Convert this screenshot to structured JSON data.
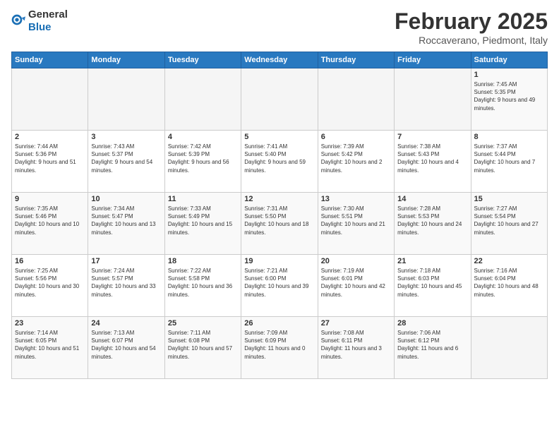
{
  "logo": {
    "general": "General",
    "blue": "Blue"
  },
  "header": {
    "month": "February 2025",
    "location": "Roccaverano, Piedmont, Italy"
  },
  "weekdays": [
    "Sunday",
    "Monday",
    "Tuesday",
    "Wednesday",
    "Thursday",
    "Friday",
    "Saturday"
  ],
  "weeks": [
    [
      {
        "day": "",
        "info": ""
      },
      {
        "day": "",
        "info": ""
      },
      {
        "day": "",
        "info": ""
      },
      {
        "day": "",
        "info": ""
      },
      {
        "day": "",
        "info": ""
      },
      {
        "day": "",
        "info": ""
      },
      {
        "day": "1",
        "info": "Sunrise: 7:45 AM\nSunset: 5:35 PM\nDaylight: 9 hours and 49 minutes."
      }
    ],
    [
      {
        "day": "2",
        "info": "Sunrise: 7:44 AM\nSunset: 5:36 PM\nDaylight: 9 hours and 51 minutes."
      },
      {
        "day": "3",
        "info": "Sunrise: 7:43 AM\nSunset: 5:37 PM\nDaylight: 9 hours and 54 minutes."
      },
      {
        "day": "4",
        "info": "Sunrise: 7:42 AM\nSunset: 5:39 PM\nDaylight: 9 hours and 56 minutes."
      },
      {
        "day": "5",
        "info": "Sunrise: 7:41 AM\nSunset: 5:40 PM\nDaylight: 9 hours and 59 minutes."
      },
      {
        "day": "6",
        "info": "Sunrise: 7:39 AM\nSunset: 5:42 PM\nDaylight: 10 hours and 2 minutes."
      },
      {
        "day": "7",
        "info": "Sunrise: 7:38 AM\nSunset: 5:43 PM\nDaylight: 10 hours and 4 minutes."
      },
      {
        "day": "8",
        "info": "Sunrise: 7:37 AM\nSunset: 5:44 PM\nDaylight: 10 hours and 7 minutes."
      }
    ],
    [
      {
        "day": "9",
        "info": "Sunrise: 7:35 AM\nSunset: 5:46 PM\nDaylight: 10 hours and 10 minutes."
      },
      {
        "day": "10",
        "info": "Sunrise: 7:34 AM\nSunset: 5:47 PM\nDaylight: 10 hours and 13 minutes."
      },
      {
        "day": "11",
        "info": "Sunrise: 7:33 AM\nSunset: 5:49 PM\nDaylight: 10 hours and 15 minutes."
      },
      {
        "day": "12",
        "info": "Sunrise: 7:31 AM\nSunset: 5:50 PM\nDaylight: 10 hours and 18 minutes."
      },
      {
        "day": "13",
        "info": "Sunrise: 7:30 AM\nSunset: 5:51 PM\nDaylight: 10 hours and 21 minutes."
      },
      {
        "day": "14",
        "info": "Sunrise: 7:28 AM\nSunset: 5:53 PM\nDaylight: 10 hours and 24 minutes."
      },
      {
        "day": "15",
        "info": "Sunrise: 7:27 AM\nSunset: 5:54 PM\nDaylight: 10 hours and 27 minutes."
      }
    ],
    [
      {
        "day": "16",
        "info": "Sunrise: 7:25 AM\nSunset: 5:56 PM\nDaylight: 10 hours and 30 minutes."
      },
      {
        "day": "17",
        "info": "Sunrise: 7:24 AM\nSunset: 5:57 PM\nDaylight: 10 hours and 33 minutes."
      },
      {
        "day": "18",
        "info": "Sunrise: 7:22 AM\nSunset: 5:58 PM\nDaylight: 10 hours and 36 minutes."
      },
      {
        "day": "19",
        "info": "Sunrise: 7:21 AM\nSunset: 6:00 PM\nDaylight: 10 hours and 39 minutes."
      },
      {
        "day": "20",
        "info": "Sunrise: 7:19 AM\nSunset: 6:01 PM\nDaylight: 10 hours and 42 minutes."
      },
      {
        "day": "21",
        "info": "Sunrise: 7:18 AM\nSunset: 6:03 PM\nDaylight: 10 hours and 45 minutes."
      },
      {
        "day": "22",
        "info": "Sunrise: 7:16 AM\nSunset: 6:04 PM\nDaylight: 10 hours and 48 minutes."
      }
    ],
    [
      {
        "day": "23",
        "info": "Sunrise: 7:14 AM\nSunset: 6:05 PM\nDaylight: 10 hours and 51 minutes."
      },
      {
        "day": "24",
        "info": "Sunrise: 7:13 AM\nSunset: 6:07 PM\nDaylight: 10 hours and 54 minutes."
      },
      {
        "day": "25",
        "info": "Sunrise: 7:11 AM\nSunset: 6:08 PM\nDaylight: 10 hours and 57 minutes."
      },
      {
        "day": "26",
        "info": "Sunrise: 7:09 AM\nSunset: 6:09 PM\nDaylight: 11 hours and 0 minutes."
      },
      {
        "day": "27",
        "info": "Sunrise: 7:08 AM\nSunset: 6:11 PM\nDaylight: 11 hours and 3 minutes."
      },
      {
        "day": "28",
        "info": "Sunrise: 7:06 AM\nSunset: 6:12 PM\nDaylight: 11 hours and 6 minutes."
      },
      {
        "day": "",
        "info": ""
      }
    ]
  ]
}
